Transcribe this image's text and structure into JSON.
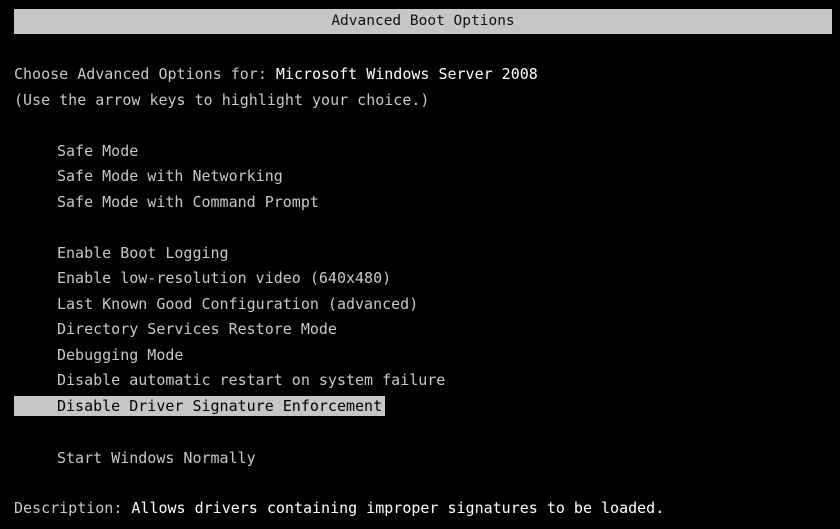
{
  "title": "Advanced Boot Options",
  "header": {
    "prefix": "Choose Advanced Options for: ",
    "os_name": "Microsoft Windows Server 2008",
    "instruction": "(Use the arrow keys to highlight your choice.)"
  },
  "options_group1": [
    {
      "label": "Safe Mode"
    },
    {
      "label": "Safe Mode with Networking"
    },
    {
      "label": "Safe Mode with Command Prompt"
    }
  ],
  "options_group2": [
    {
      "label": "Enable Boot Logging"
    },
    {
      "label": "Enable low-resolution video (640x480)"
    },
    {
      "label": "Last Known Good Configuration (advanced)"
    },
    {
      "label": "Directory Services Restore Mode"
    },
    {
      "label": "Debugging Mode"
    },
    {
      "label": "Disable automatic restart on system failure"
    },
    {
      "label": "Disable Driver Signature Enforcement",
      "selected": true
    }
  ],
  "options_group3": [
    {
      "label": "Start Windows Normally"
    }
  ],
  "description": {
    "label": "Description: ",
    "text": "Allows drivers containing improper signatures to be loaded."
  },
  "colors": {
    "background": "#000000",
    "text": "#c8c8c8",
    "highlight_bg": "#c6c6c6",
    "highlight_text": "#000000"
  }
}
